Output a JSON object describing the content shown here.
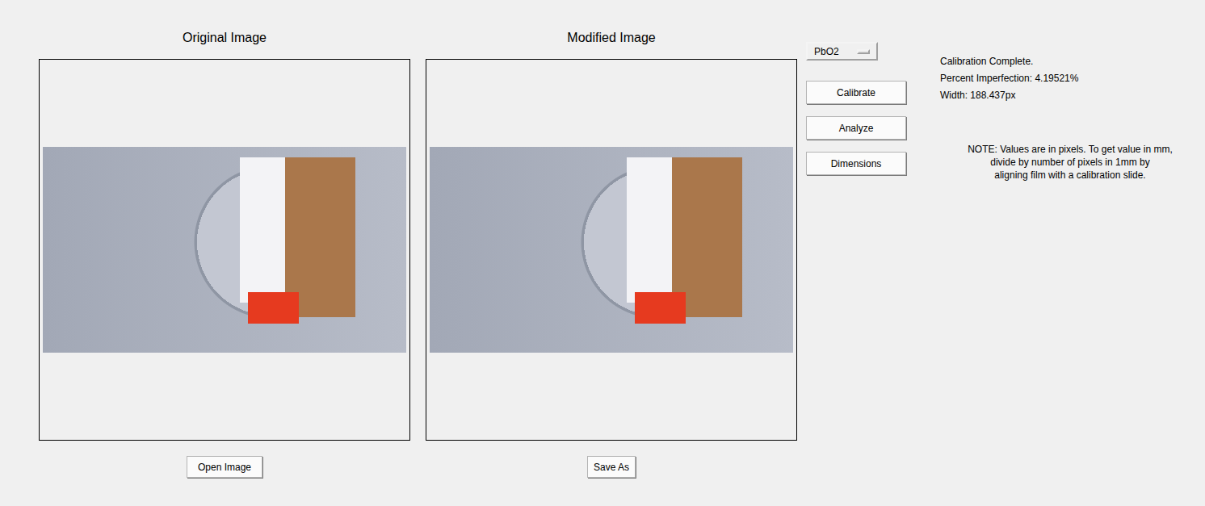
{
  "panels": [
    {
      "title": "Original Image",
      "button": "Open Image"
    },
    {
      "title": "Modified Image",
      "button": "Save As"
    }
  ],
  "dropdown": {
    "value": "PbO2"
  },
  "buttons": [
    "Calibrate",
    "Analyze",
    "Dimensions"
  ],
  "status": [
    "Calibration Complete.",
    "Percent Imperfection: 4.19521%",
    "Width: 188.437px"
  ],
  "note": [
    "NOTE: Values are in pixels. To get value in mm,",
    "divide by number of pixels in 1mm by",
    "aligning film with a calibration slide."
  ]
}
